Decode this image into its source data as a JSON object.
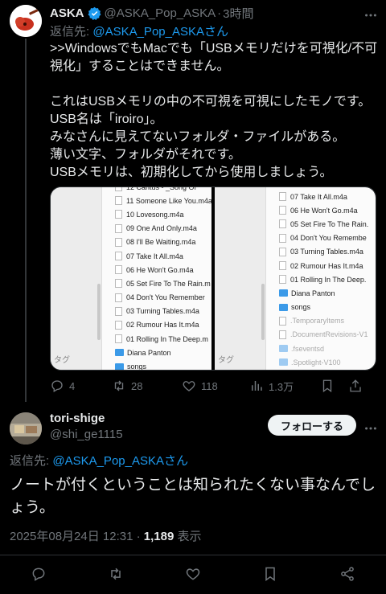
{
  "tweet1": {
    "name": "ASKA",
    "handle": "@ASKA_Pop_ASKA",
    "sep": "·",
    "time": "3時間",
    "reply_prefix": "返信先: ",
    "reply_handle": "@ASKA_Pop_ASKAさん",
    "body": ">>WindowsでもMacでも「USBメモリだけを可視化/不可視化」することはできません。\n\nこれはUSBメモリの中の不可視を可視にしたモノです。USB名は「iroiro」。\nみなさんに見えてないフォルダ・ファイルがある。\n薄い文字、フォルダがそれです。\nUSBメモリは、初期化してから使用しましょう。",
    "media_left": {
      "sidebar_label": "タグ",
      "items": [
        {
          "icon": "file",
          "label": "12 Cantus - _Song Of"
        },
        {
          "icon": "file",
          "label": "11 Someone Like You.m4a"
        },
        {
          "icon": "file",
          "label": "10 Lovesong.m4a"
        },
        {
          "icon": "file",
          "label": "09 One And Only.m4a"
        },
        {
          "icon": "file",
          "label": "08 I'll Be Waiting.m4a"
        },
        {
          "icon": "file",
          "label": "07 Take It All.m4a"
        },
        {
          "icon": "file",
          "label": "06 He Won't Go.m4a"
        },
        {
          "icon": "file",
          "label": "05 Set Fire To The Rain.m"
        },
        {
          "icon": "file",
          "label": "04 Don't You Remember"
        },
        {
          "icon": "file",
          "label": "03 Turning Tables.m4a"
        },
        {
          "icon": "file",
          "label": "02 Rumour Has It.m4a"
        },
        {
          "icon": "file",
          "label": "01 Rolling In The Deep.m"
        },
        {
          "icon": "folder",
          "label": "Diana Panton"
        },
        {
          "icon": "folder",
          "label": "songs"
        }
      ]
    },
    "media_right": {
      "sidebar_label": "タグ",
      "items": [
        {
          "icon": "file",
          "label": "07 Take It All.m4a"
        },
        {
          "icon": "file",
          "label": "06 He Won't Go.m4a"
        },
        {
          "icon": "file",
          "label": "05 Set Fire To The Rain."
        },
        {
          "icon": "file",
          "label": "04 Don't You Remembe"
        },
        {
          "icon": "file",
          "label": "03 Turning Tables.m4a"
        },
        {
          "icon": "file",
          "label": "02 Rumour Has It.m4a"
        },
        {
          "icon": "file",
          "label": "01 Rolling In The Deep."
        },
        {
          "icon": "folder",
          "label": "Diana Panton"
        },
        {
          "icon": "folder",
          "label": "songs"
        },
        {
          "icon": "file",
          "label": ".TemporaryItems",
          "faded": true
        },
        {
          "icon": "file",
          "label": ".DocumentRevisions-V1",
          "faded": true
        },
        {
          "icon": "folder",
          "label": ".fseventsd",
          "faded": true
        },
        {
          "icon": "folder",
          "label": ".Spotlight-V100",
          "faded": true
        }
      ]
    },
    "stats": {
      "replies": "4",
      "reposts": "28",
      "likes": "118",
      "views": "1.3万"
    }
  },
  "tweet2": {
    "name": "tori-shige",
    "handle": "@shi_ge1115",
    "follow_label": "フォローする",
    "reply_prefix": "返信先: ",
    "reply_handle": "@ASKA_Pop_ASKAさん",
    "body": "ノートが付くということは知られたくない事なんでしょう。",
    "datetime": "2025年08月24日 12:31",
    "sep": " · ",
    "view_count": "1,189",
    "view_label": " 表示"
  },
  "colors": {
    "accent": "#1d9bf0",
    "muted": "#71767b",
    "text": "#e7e9ea",
    "background": "#000000"
  }
}
